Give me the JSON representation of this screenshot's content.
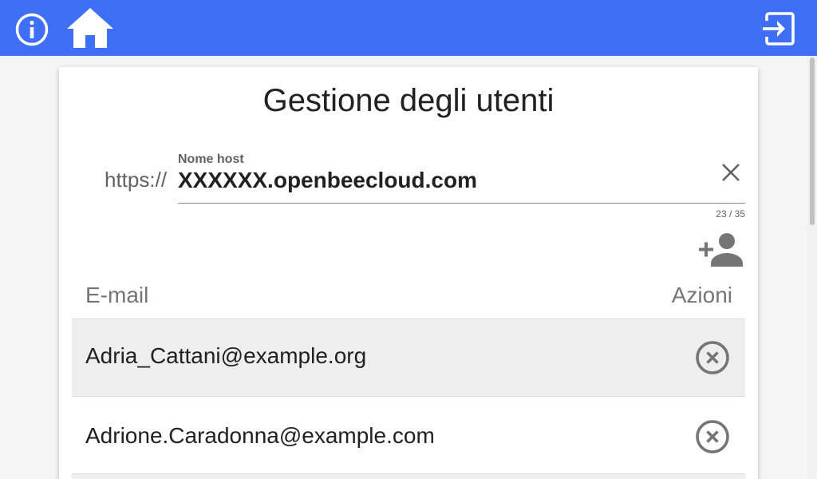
{
  "header": {
    "info_icon": "info-icon",
    "home_icon": "home-icon",
    "logout_icon": "logout-icon",
    "background_color": "#3f6ff6"
  },
  "page": {
    "title": "Gestione degli utenti"
  },
  "host_field": {
    "prefix": "https://",
    "label": "Nome host",
    "value": "XXXXXX.openbeecloud.com",
    "counter": "23 / 35",
    "clear_icon": "close-icon"
  },
  "toolbar": {
    "add_user_icon": "add-user-icon"
  },
  "table": {
    "headers": {
      "email": "E-mail",
      "actions": "Azioni"
    },
    "rows": [
      {
        "email": "Adria_Cattani@example.org",
        "action_icon": "remove-circle-icon"
      },
      {
        "email": "Adrione.Caradonna@example.com",
        "action_icon": "remove-circle-icon"
      }
    ]
  }
}
